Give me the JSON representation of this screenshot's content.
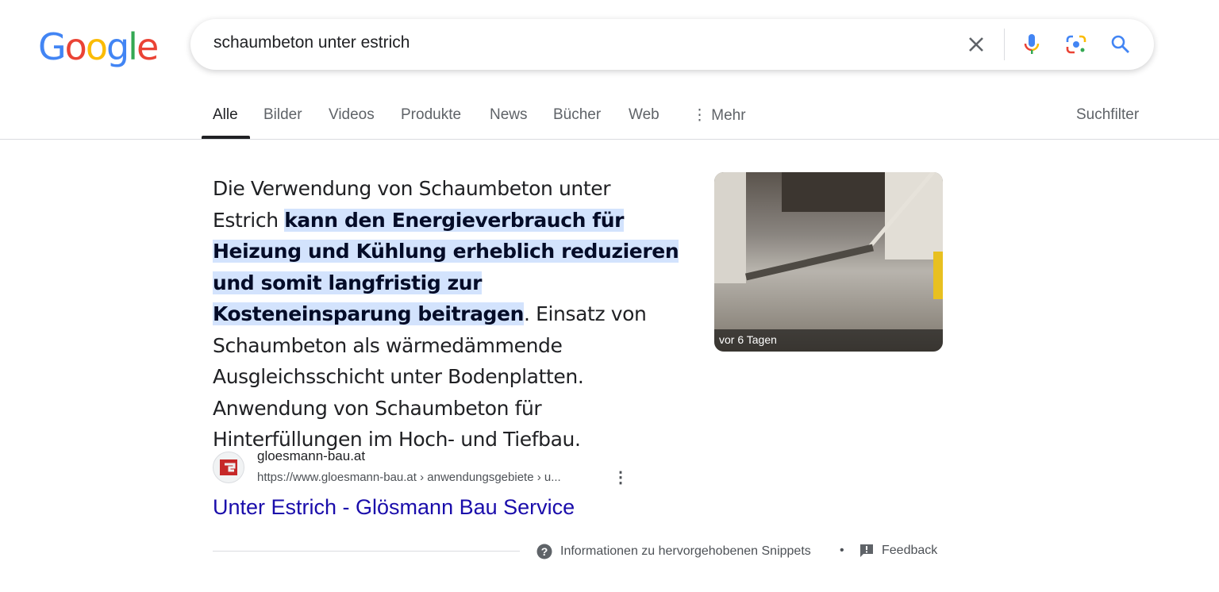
{
  "logo": {
    "letters": [
      "G",
      "o",
      "o",
      "g",
      "l",
      "e"
    ],
    "colors": [
      "#4285f4",
      "#ea4335",
      "#fbbc05",
      "#4285f4",
      "#34a853",
      "#ea4335"
    ]
  },
  "search": {
    "query": "schaumbeton unter estrich"
  },
  "tabs": [
    {
      "label": "Alle"
    },
    {
      "label": "Bilder"
    },
    {
      "label": "Videos"
    },
    {
      "label": "Produkte"
    },
    {
      "label": "News"
    },
    {
      "label": "Bücher"
    },
    {
      "label": "Web"
    },
    {
      "label": "Mehr"
    }
  ],
  "filter_label": "Suchfilter",
  "snippet": {
    "before": "Die Verwendung von Schaumbeton unter Estrich ",
    "highlight": "kann den Energieverbrauch für Heizung und Kühlung erheblich reduzieren und somit langfristig zur Kosteneinsparung beitragen",
    "after": ". Einsatz von Schaumbeton als wärmedämmende Ausgleichsschicht unter Bodenplatten. Anwendung von Schaumbeton für Hinterfüllungen im Hoch- und Tiefbau."
  },
  "thumbnail": {
    "caption": "vor 6 Tagen"
  },
  "result": {
    "site": "gloesmann-bau.at",
    "url": "https://www.gloesmann-bau.at › anwendungsgebiete › u...",
    "title": "Unter Estrich - Glösmann Bau Service"
  },
  "footer": {
    "info": "Informationen zu hervorgehobenen Snippets",
    "feedback": "Feedback",
    "dot": "•"
  }
}
